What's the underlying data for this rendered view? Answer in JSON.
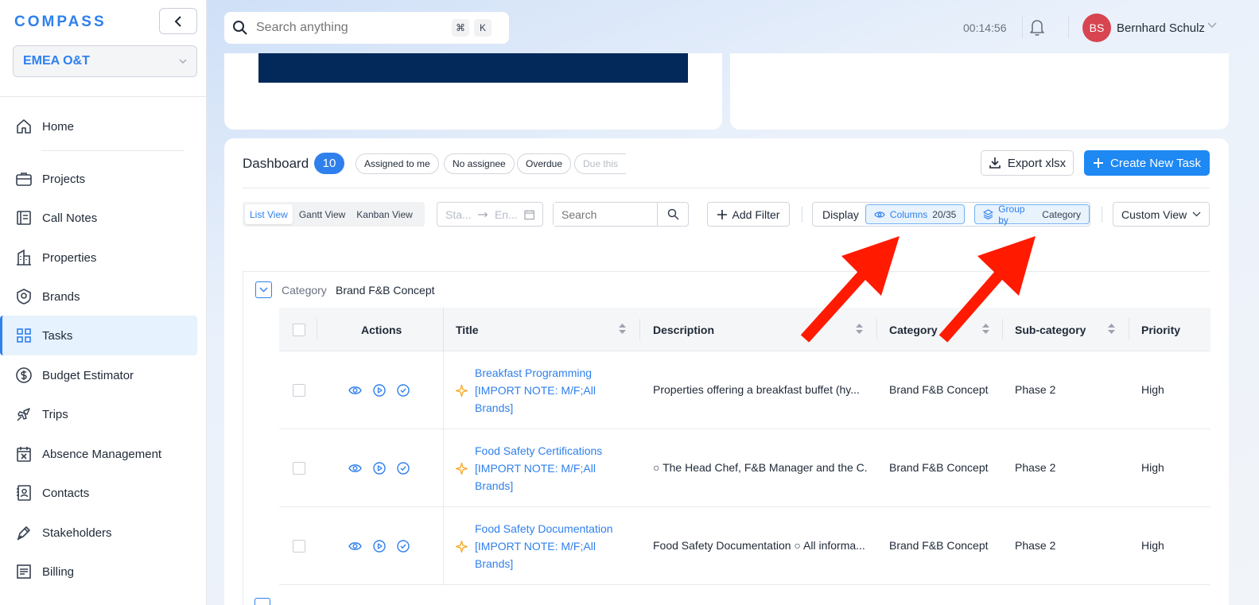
{
  "app": {
    "logo": "COMPASS",
    "org": "EMEA O&T"
  },
  "sidebar": {
    "items": [
      {
        "label": "Home",
        "icon": "home-icon"
      },
      {
        "label": "Projects",
        "icon": "briefcase-icon"
      },
      {
        "label": "Call Notes",
        "icon": "notes-icon"
      },
      {
        "label": "Properties",
        "icon": "building-icon"
      },
      {
        "label": "Brands",
        "icon": "badge-icon"
      },
      {
        "label": "Tasks",
        "icon": "grid-icon",
        "active": true
      },
      {
        "label": "Budget Estimator",
        "icon": "dollar-icon"
      },
      {
        "label": "Trips",
        "icon": "plane-icon"
      },
      {
        "label": "Absence Management",
        "icon": "calendar-x-icon"
      },
      {
        "label": "Contacts",
        "icon": "contact-book-icon"
      },
      {
        "label": "Stakeholders",
        "icon": "pen-icon"
      },
      {
        "label": "Billing",
        "icon": "receipt-icon"
      }
    ]
  },
  "topbar": {
    "search_placeholder": "Search anything",
    "kbd_cmd": "⌘",
    "kbd_k": "K",
    "timer": "00:14:56",
    "user_initials": "BS",
    "user_name": "Bernhard Schulz"
  },
  "dashboard": {
    "title": "Dashboard",
    "count": "10",
    "quick_filters": [
      "Assigned to me",
      "No assignee",
      "Overdue",
      "Due this"
    ],
    "export_label": "Export xlsx",
    "create_label": "Create New Task",
    "views": [
      "List View",
      "Gantt View",
      "Kanban View"
    ],
    "active_view": "List View",
    "date_start_placeholder": "Sta...",
    "date_end_placeholder": "En...",
    "search_placeholder": "Search",
    "add_filter_label": "Add Filter",
    "display_label": "Display",
    "columns_label": "Columns",
    "columns_value": "20/35",
    "group_by_label": "Group by",
    "group_by_value": "Category",
    "custom_view_label": "Custom View"
  },
  "group": {
    "label": "Category",
    "value": "Brand F&B Concept"
  },
  "table": {
    "columns": [
      "Actions",
      "Title",
      "Description",
      "Category",
      "Sub-category",
      "Priority"
    ],
    "rows": [
      {
        "title": "Breakfast Programming [IMPORT NOTE: M/F;All Brands]",
        "description": "Properties offering a breakfast buffet (hy...",
        "category": "Brand F&B Concept",
        "subcategory": "Phase 2",
        "priority": "High"
      },
      {
        "title": "Food Safety Certifications [IMPORT NOTE: M/F;All Brands]",
        "description": "○ The Head Chef, F&B Manager and the C...",
        "category": "Brand F&B Concept",
        "subcategory": "Phase 2",
        "priority": "High"
      },
      {
        "title": "Food Safety Documentation [IMPORT NOTE: M/F;All Brands]",
        "description": "Food Safety Documentation ○ All informa...",
        "category": "Brand F&B Concept",
        "subcategory": "Phase 2",
        "priority": "High"
      }
    ]
  },
  "colors": {
    "accent": "#2f80ed",
    "primary_button": "#1e88f3",
    "banner": "#03295a",
    "avatar": "#d64550",
    "star": "#f5a623",
    "annotation_arrow": "#ff1a00"
  }
}
